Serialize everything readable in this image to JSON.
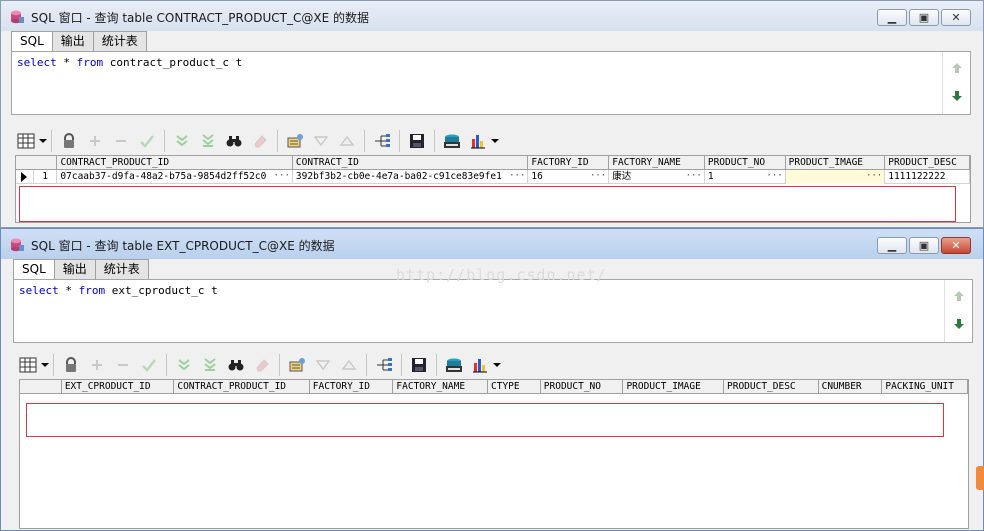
{
  "window1": {
    "title": "SQL 窗口 - 查询 table CONTRACT_PRODUCT_C@XE 的数据",
    "tabs": [
      "SQL",
      "输出",
      "统计表"
    ],
    "sql": {
      "kw1": "select",
      "rest1": " * ",
      "kw2": "from",
      "rest2": " contract_product_c t"
    },
    "columns": [
      "CONTRACT_PRODUCT_ID",
      "CONTRACT_ID",
      "FACTORY_ID",
      "FACTORY_NAME",
      "PRODUCT_NO",
      "PRODUCT_IMAGE",
      "PRODUCT_DESC"
    ],
    "rows": [
      {
        "num": "1",
        "cells": [
          "07caab37-d9fa-48a2-b75a-9854d2ff52c0",
          "392bf3b2-cb0e-4e7a-ba02-c91ce83e9fe1",
          "16",
          "康达",
          "1",
          "",
          "1111122222"
        ]
      }
    ]
  },
  "window2": {
    "title": "SQL 窗口 - 查询 table EXT_CPRODUCT_C@XE 的数据",
    "tabs": [
      "SQL",
      "输出",
      "统计表"
    ],
    "sql": {
      "kw1": "select",
      "rest1": " * ",
      "kw2": "from",
      "rest2": " ext_cproduct_c t"
    },
    "columns": [
      "EXT_CPRODUCT_ID",
      "CONTRACT_PRODUCT_ID",
      "FACTORY_ID",
      "FACTORY_NAME",
      "CTYPE",
      "PRODUCT_NO",
      "PRODUCT_IMAGE",
      "PRODUCT_DESC",
      "CNUMBER",
      "PACKING_UNIT"
    ]
  },
  "watermark": "http://blog.csdn.net/",
  "colors": {
    "keyword": "#0000cc",
    "highlight_box": "#d9373b"
  }
}
